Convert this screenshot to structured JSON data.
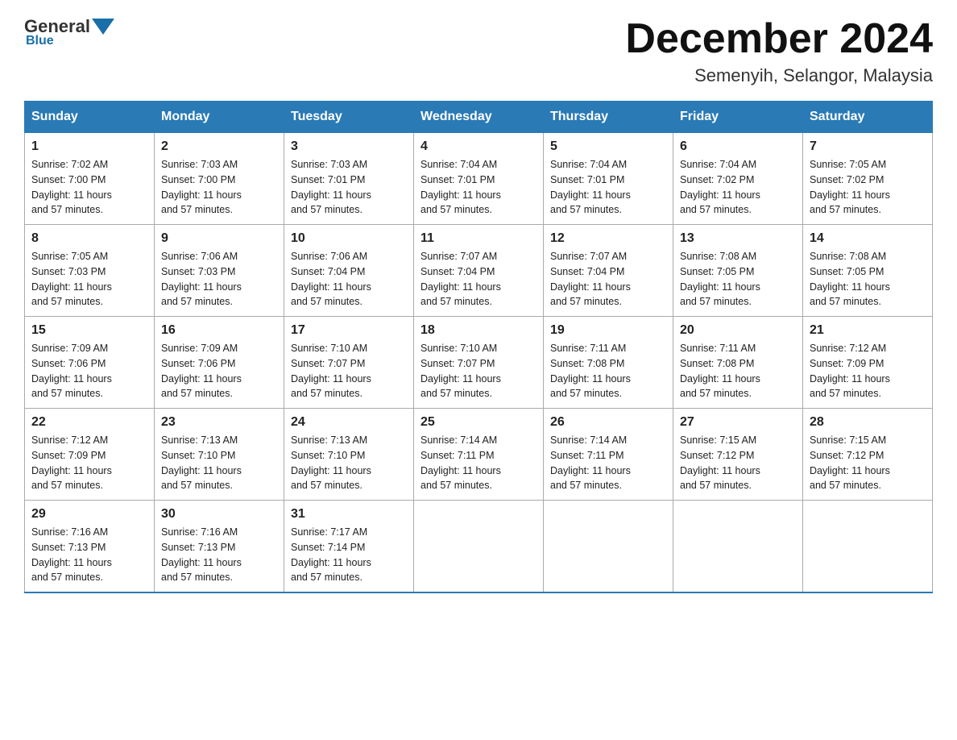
{
  "header": {
    "logo_general": "General",
    "logo_blue": "Blue",
    "month_title": "December 2024",
    "location": "Semenyih, Selangor, Malaysia"
  },
  "days_of_week": [
    "Sunday",
    "Monday",
    "Tuesday",
    "Wednesday",
    "Thursday",
    "Friday",
    "Saturday"
  ],
  "weeks": [
    [
      {
        "day": "1",
        "sunrise": "7:02 AM",
        "sunset": "7:00 PM",
        "daylight": "11 hours and 57 minutes."
      },
      {
        "day": "2",
        "sunrise": "7:03 AM",
        "sunset": "7:00 PM",
        "daylight": "11 hours and 57 minutes."
      },
      {
        "day": "3",
        "sunrise": "7:03 AM",
        "sunset": "7:01 PM",
        "daylight": "11 hours and 57 minutes."
      },
      {
        "day": "4",
        "sunrise": "7:04 AM",
        "sunset": "7:01 PM",
        "daylight": "11 hours and 57 minutes."
      },
      {
        "day": "5",
        "sunrise": "7:04 AM",
        "sunset": "7:01 PM",
        "daylight": "11 hours and 57 minutes."
      },
      {
        "day": "6",
        "sunrise": "7:04 AM",
        "sunset": "7:02 PM",
        "daylight": "11 hours and 57 minutes."
      },
      {
        "day": "7",
        "sunrise": "7:05 AM",
        "sunset": "7:02 PM",
        "daylight": "11 hours and 57 minutes."
      }
    ],
    [
      {
        "day": "8",
        "sunrise": "7:05 AM",
        "sunset": "7:03 PM",
        "daylight": "11 hours and 57 minutes."
      },
      {
        "day": "9",
        "sunrise": "7:06 AM",
        "sunset": "7:03 PM",
        "daylight": "11 hours and 57 minutes."
      },
      {
        "day": "10",
        "sunrise": "7:06 AM",
        "sunset": "7:04 PM",
        "daylight": "11 hours and 57 minutes."
      },
      {
        "day": "11",
        "sunrise": "7:07 AM",
        "sunset": "7:04 PM",
        "daylight": "11 hours and 57 minutes."
      },
      {
        "day": "12",
        "sunrise": "7:07 AM",
        "sunset": "7:04 PM",
        "daylight": "11 hours and 57 minutes."
      },
      {
        "day": "13",
        "sunrise": "7:08 AM",
        "sunset": "7:05 PM",
        "daylight": "11 hours and 57 minutes."
      },
      {
        "day": "14",
        "sunrise": "7:08 AM",
        "sunset": "7:05 PM",
        "daylight": "11 hours and 57 minutes."
      }
    ],
    [
      {
        "day": "15",
        "sunrise": "7:09 AM",
        "sunset": "7:06 PM",
        "daylight": "11 hours and 57 minutes."
      },
      {
        "day": "16",
        "sunrise": "7:09 AM",
        "sunset": "7:06 PM",
        "daylight": "11 hours and 57 minutes."
      },
      {
        "day": "17",
        "sunrise": "7:10 AM",
        "sunset": "7:07 PM",
        "daylight": "11 hours and 57 minutes."
      },
      {
        "day": "18",
        "sunrise": "7:10 AM",
        "sunset": "7:07 PM",
        "daylight": "11 hours and 57 minutes."
      },
      {
        "day": "19",
        "sunrise": "7:11 AM",
        "sunset": "7:08 PM",
        "daylight": "11 hours and 57 minutes."
      },
      {
        "day": "20",
        "sunrise": "7:11 AM",
        "sunset": "7:08 PM",
        "daylight": "11 hours and 57 minutes."
      },
      {
        "day": "21",
        "sunrise": "7:12 AM",
        "sunset": "7:09 PM",
        "daylight": "11 hours and 57 minutes."
      }
    ],
    [
      {
        "day": "22",
        "sunrise": "7:12 AM",
        "sunset": "7:09 PM",
        "daylight": "11 hours and 57 minutes."
      },
      {
        "day": "23",
        "sunrise": "7:13 AM",
        "sunset": "7:10 PM",
        "daylight": "11 hours and 57 minutes."
      },
      {
        "day": "24",
        "sunrise": "7:13 AM",
        "sunset": "7:10 PM",
        "daylight": "11 hours and 57 minutes."
      },
      {
        "day": "25",
        "sunrise": "7:14 AM",
        "sunset": "7:11 PM",
        "daylight": "11 hours and 57 minutes."
      },
      {
        "day": "26",
        "sunrise": "7:14 AM",
        "sunset": "7:11 PM",
        "daylight": "11 hours and 57 minutes."
      },
      {
        "day": "27",
        "sunrise": "7:15 AM",
        "sunset": "7:12 PM",
        "daylight": "11 hours and 57 minutes."
      },
      {
        "day": "28",
        "sunrise": "7:15 AM",
        "sunset": "7:12 PM",
        "daylight": "11 hours and 57 minutes."
      }
    ],
    [
      {
        "day": "29",
        "sunrise": "7:16 AM",
        "sunset": "7:13 PM",
        "daylight": "11 hours and 57 minutes."
      },
      {
        "day": "30",
        "sunrise": "7:16 AM",
        "sunset": "7:13 PM",
        "daylight": "11 hours and 57 minutes."
      },
      {
        "day": "31",
        "sunrise": "7:17 AM",
        "sunset": "7:14 PM",
        "daylight": "11 hours and 57 minutes."
      },
      null,
      null,
      null,
      null
    ]
  ]
}
